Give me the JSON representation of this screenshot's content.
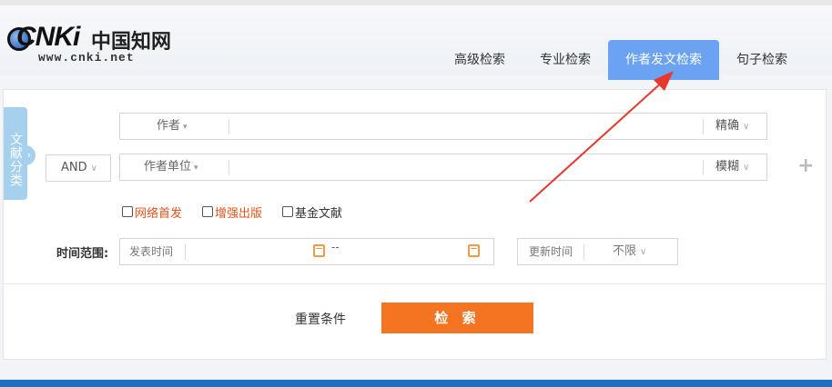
{
  "logo": {
    "brand": "CNKi",
    "chinese": "中国知网",
    "url": "www.cnki.net"
  },
  "tabs": [
    {
      "label": "高级检索",
      "active": false
    },
    {
      "label": "专业检索",
      "active": false
    },
    {
      "label": "作者发文检索",
      "active": true
    },
    {
      "label": "句子检索",
      "active": false
    }
  ],
  "sidebar": {
    "label": "文献分类"
  },
  "rows": [
    {
      "field": "作者",
      "match": "精确"
    },
    {
      "logic": "AND",
      "field": "作者单位",
      "match": "模糊"
    }
  ],
  "checkboxes": [
    {
      "label": "网络首发",
      "checked": false
    },
    {
      "label": "增强出版",
      "checked": false
    },
    {
      "label": "基金文献",
      "checked": false
    }
  ],
  "time": {
    "label": "时间范围:",
    "publish_label": "发表时间",
    "range_sep": "--",
    "update_label": "更新时间",
    "update_value": "不限"
  },
  "actions": {
    "reset": "重置条件",
    "search": "检 索"
  },
  "colors": {
    "accent": "#f47421",
    "tab_active": "#6ba3f2",
    "sidebar": "#a5d0ee",
    "checkbox_text": "#e4521c",
    "annotation_arrow": "#e8382d"
  }
}
